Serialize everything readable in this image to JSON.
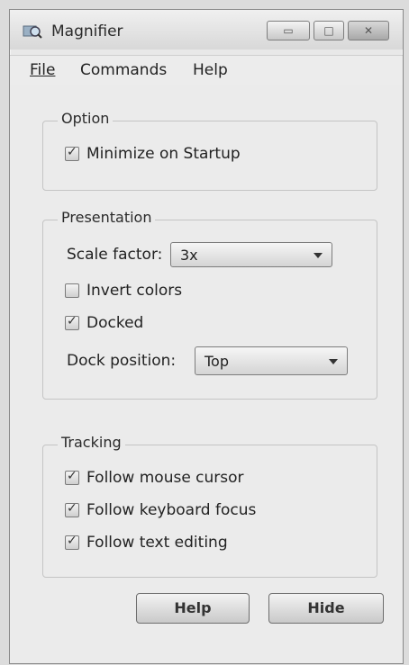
{
  "window": {
    "title": "Magnifier",
    "icon": "magnifier-app-icon"
  },
  "menu": {
    "file": "File",
    "commands": "Commands",
    "help": "Help"
  },
  "option_group": {
    "legend": "Option",
    "minimize_on_startup": {
      "label": "Minimize on Startup",
      "checked": true
    }
  },
  "presentation_group": {
    "legend": "Presentation",
    "scale_factor_label": "Scale factor:",
    "scale_factor_value": "3x",
    "invert_colors": {
      "label": "Invert colors",
      "checked": false
    },
    "docked": {
      "label": "Docked",
      "checked": true
    },
    "dock_position_label": "Dock position:",
    "dock_position_value": "Top"
  },
  "tracking_group": {
    "legend": "Tracking",
    "follow_mouse": {
      "label": "Follow mouse cursor",
      "checked": true
    },
    "follow_keyboard": {
      "label": "Follow keyboard focus",
      "checked": true
    },
    "follow_text": {
      "label": "Follow text editing",
      "checked": true
    }
  },
  "buttons": {
    "help": "Help",
    "hide": "Hide"
  }
}
